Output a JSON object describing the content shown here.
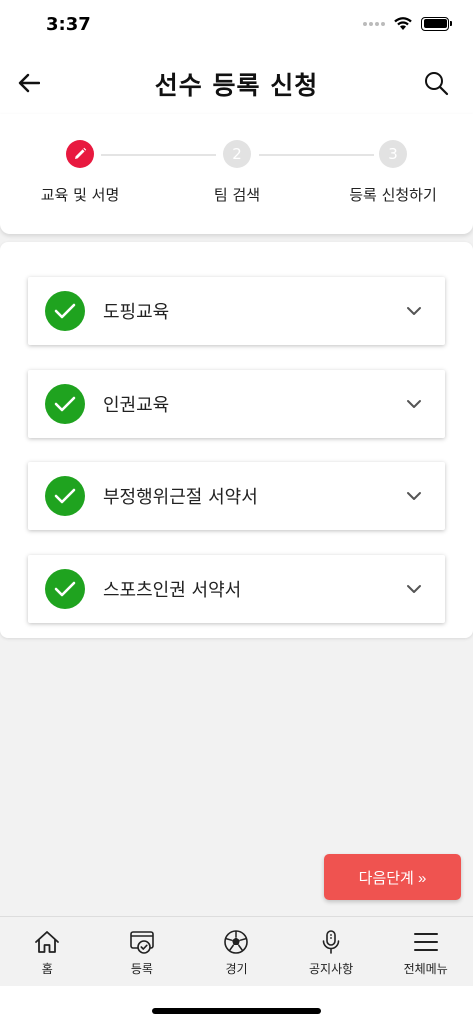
{
  "status_bar": {
    "time": "3:37"
  },
  "header": {
    "title": "선수 등록 신청"
  },
  "stepper": {
    "steps": [
      {
        "number": "",
        "label": "교육 및 서명"
      },
      {
        "number": "2",
        "label": "팀 검색"
      },
      {
        "number": "3",
        "label": "등록 신청하기"
      }
    ]
  },
  "items": [
    {
      "label": "도핑교육"
    },
    {
      "label": "인권교육"
    },
    {
      "label": "부정행위근절 서약서"
    },
    {
      "label": "스포츠인권 서약서"
    }
  ],
  "next_button": {
    "label": "다음단계 »"
  },
  "bottom_nav": [
    {
      "label": "홈",
      "icon": "home-icon"
    },
    {
      "label": "등록",
      "icon": "registration-icon"
    },
    {
      "label": "경기",
      "icon": "soccer-ball-icon"
    },
    {
      "label": "공지사항",
      "icon": "microphone-icon"
    },
    {
      "label": "전체메뉴",
      "icon": "menu-icon"
    }
  ],
  "colors": {
    "accent": "#e8193f",
    "check": "#1fa31f",
    "next_button": "#ef5350"
  }
}
